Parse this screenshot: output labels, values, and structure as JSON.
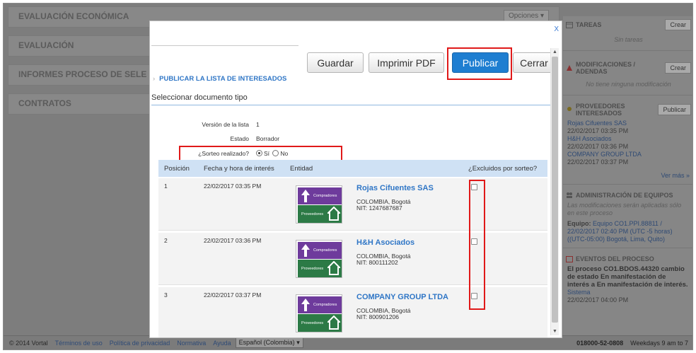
{
  "background": {
    "sections": [
      "EVALUACIÓN ECONÓMICA",
      "EVALUACIÓN",
      "INFORMES PROCESO DE SELE",
      "CONTRATOS"
    ],
    "opciones_label": "Opciones",
    "right_panel": {
      "tareas_title": "TAREAS",
      "tareas_button": "Crear",
      "tareas_empty": "Sin tareas",
      "modificaciones_title": "MODIFICACIONES / ADENDAS",
      "modificaciones_button": "Crear",
      "modificaciones_empty": "No tiene ninguna modificación",
      "proveedores_title": "PROVEEDORES INTERESADOS",
      "proveedores_button": "Publicar",
      "proveedores": [
        {
          "name": "Rojas Cifuentes SAS",
          "date": "22/02/2017 03:35 PM"
        },
        {
          "name": "H&H Asociados",
          "date": "22/02/2017 03:36 PM"
        },
        {
          "name": "COMPANY GROUP LTDA",
          "date": "22/02/2017 03:37 PM"
        }
      ],
      "ver_mas": "Ver más »",
      "admin_title": "ADMINISTRACIÓN DE EQUIPOS",
      "admin_note": "Las modificaciones serán aplicadas sólo en este proceso",
      "equipo_label": "Equipo:",
      "equipo_value": "Equipo CO1.PPI.88811 / 22/02/2017 02:40 PM (UTC -5 horas)((UTC-05:00) Bogotá, Lima, Quito)",
      "eventos_title": "EVENTOS DEL PROCESO",
      "evento_text": "El proceso CO1.BDOS.44320 cambio de estado En manifestación de interés a En manifestación de interés.",
      "evento_user": "Sistema",
      "evento_date": "22/02/2017 04:00 PM"
    },
    "footer": {
      "copyright": "© 2014 Vortal",
      "links": [
        "Términos de uso",
        "Política de privacidad",
        "Normativa",
        "Ayuda"
      ],
      "language": "Español (Colombia)",
      "phone": "018000-52-0808",
      "hours": "Weekdays 9 am to 7"
    }
  },
  "modal": {
    "close_label": "X",
    "buttons": {
      "guardar": "Guardar",
      "imprimir": "Imprimir PDF",
      "publicar": "Publicar",
      "cerrar": "Cerrar"
    },
    "breadcrumb": "PUBLICAR LA LISTA DE INTERESADOS",
    "subtitle": "Seleccionar documento tipo",
    "info": {
      "version_label": "Versión de la lista",
      "version_value": "1",
      "estado_label": "Estado",
      "estado_value": "Borrador",
      "sorteo_label": "¿Sorteo realizado?",
      "sorteo_si": "Sí",
      "sorteo_no": "No"
    },
    "table": {
      "headers": [
        "Posición",
        "Fecha y hora de interés",
        "Entidad",
        "¿Excluidos por sorteo?"
      ],
      "logo_top": "Compradores",
      "logo_bottom": "Proveedores",
      "rows": [
        {
          "position": "1",
          "datetime": "22/02/2017 03:35 PM",
          "name": "Rojas Cifuentes SAS",
          "city": "COLOMBIA, Bogotá",
          "nit": "NIT: 1247687687"
        },
        {
          "position": "2",
          "datetime": "22/02/2017 03:36 PM",
          "name": "H&H Asociados",
          "city": "COLOMBIA, Bogotá",
          "nit": "NIT: 800111202"
        },
        {
          "position": "3",
          "datetime": "22/02/2017 03:37 PM",
          "name": "COMPANY GROUP LTDA",
          "city": "COLOMBIA, Bogotá",
          "nit": "NIT: 800901206"
        }
      ]
    }
  },
  "colors": {
    "primary": "#1e7ed1",
    "highlight": "#e01919",
    "link": "#2f76c6",
    "table_header": "#cfe1f4"
  }
}
